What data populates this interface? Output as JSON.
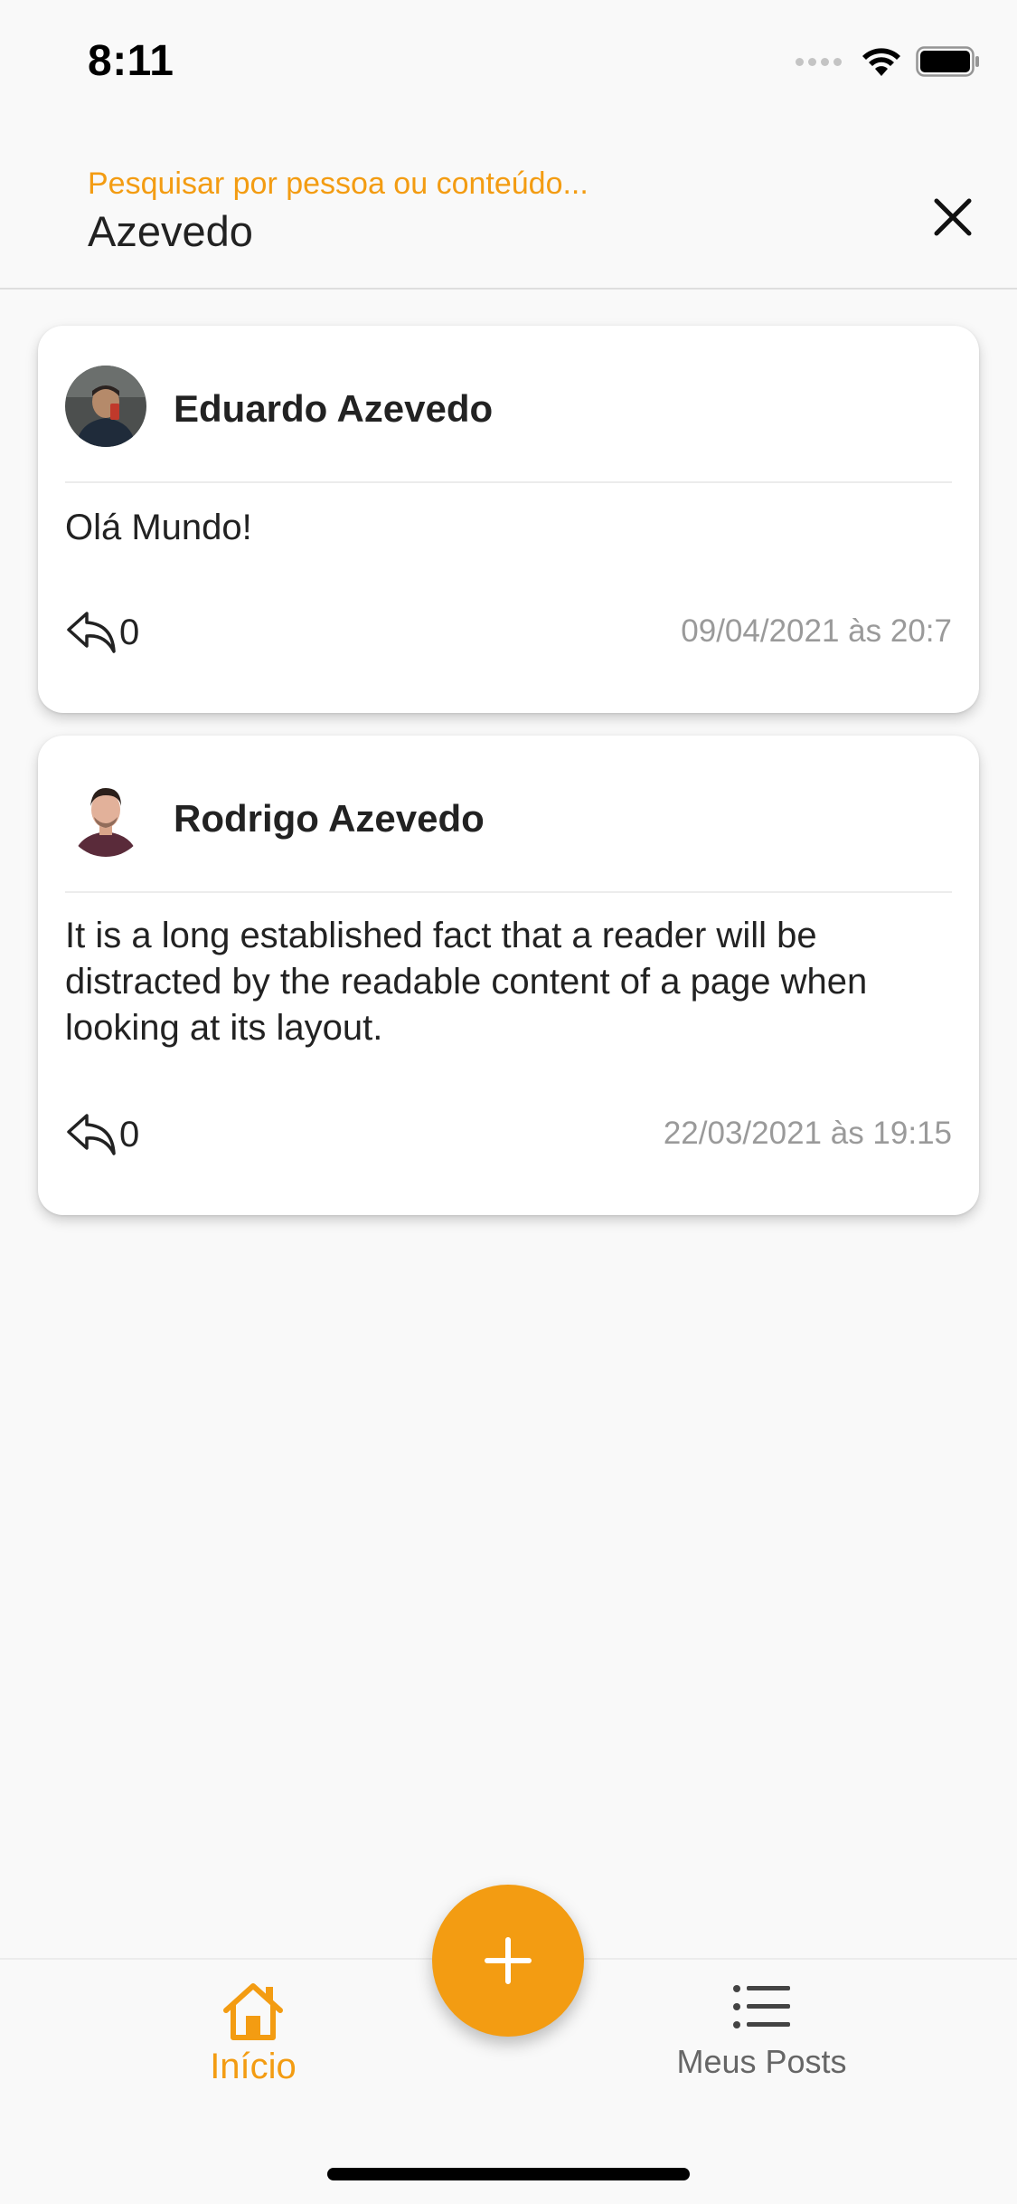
{
  "status_bar": {
    "time": "8:11"
  },
  "search": {
    "placeholder": "Pesquisar por pessoa ou conteúdo...",
    "value": "Azevedo"
  },
  "posts": [
    {
      "author": "Eduardo Azevedo",
      "text": "Olá Mundo!",
      "replies": "0",
      "date": "09/04/2021 às 20:7"
    },
    {
      "author": "Rodrigo Azevedo",
      "text": "It is a long established fact that a reader will be distracted by the readable content of a page when looking at its layout.",
      "replies": "0",
      "date": "22/03/2021 às 19:15"
    }
  ],
  "nav": {
    "home_label": "Início",
    "my_posts_label": "Meus Posts"
  },
  "colors": {
    "accent": "#f39c12",
    "background": "#f9f9f9",
    "card": "#ffffff",
    "muted_text": "#9a9a9a"
  },
  "icons": {
    "close": "close-icon",
    "reply": "reply-icon",
    "home": "home-icon",
    "list": "list-icon",
    "add": "plus-icon"
  }
}
